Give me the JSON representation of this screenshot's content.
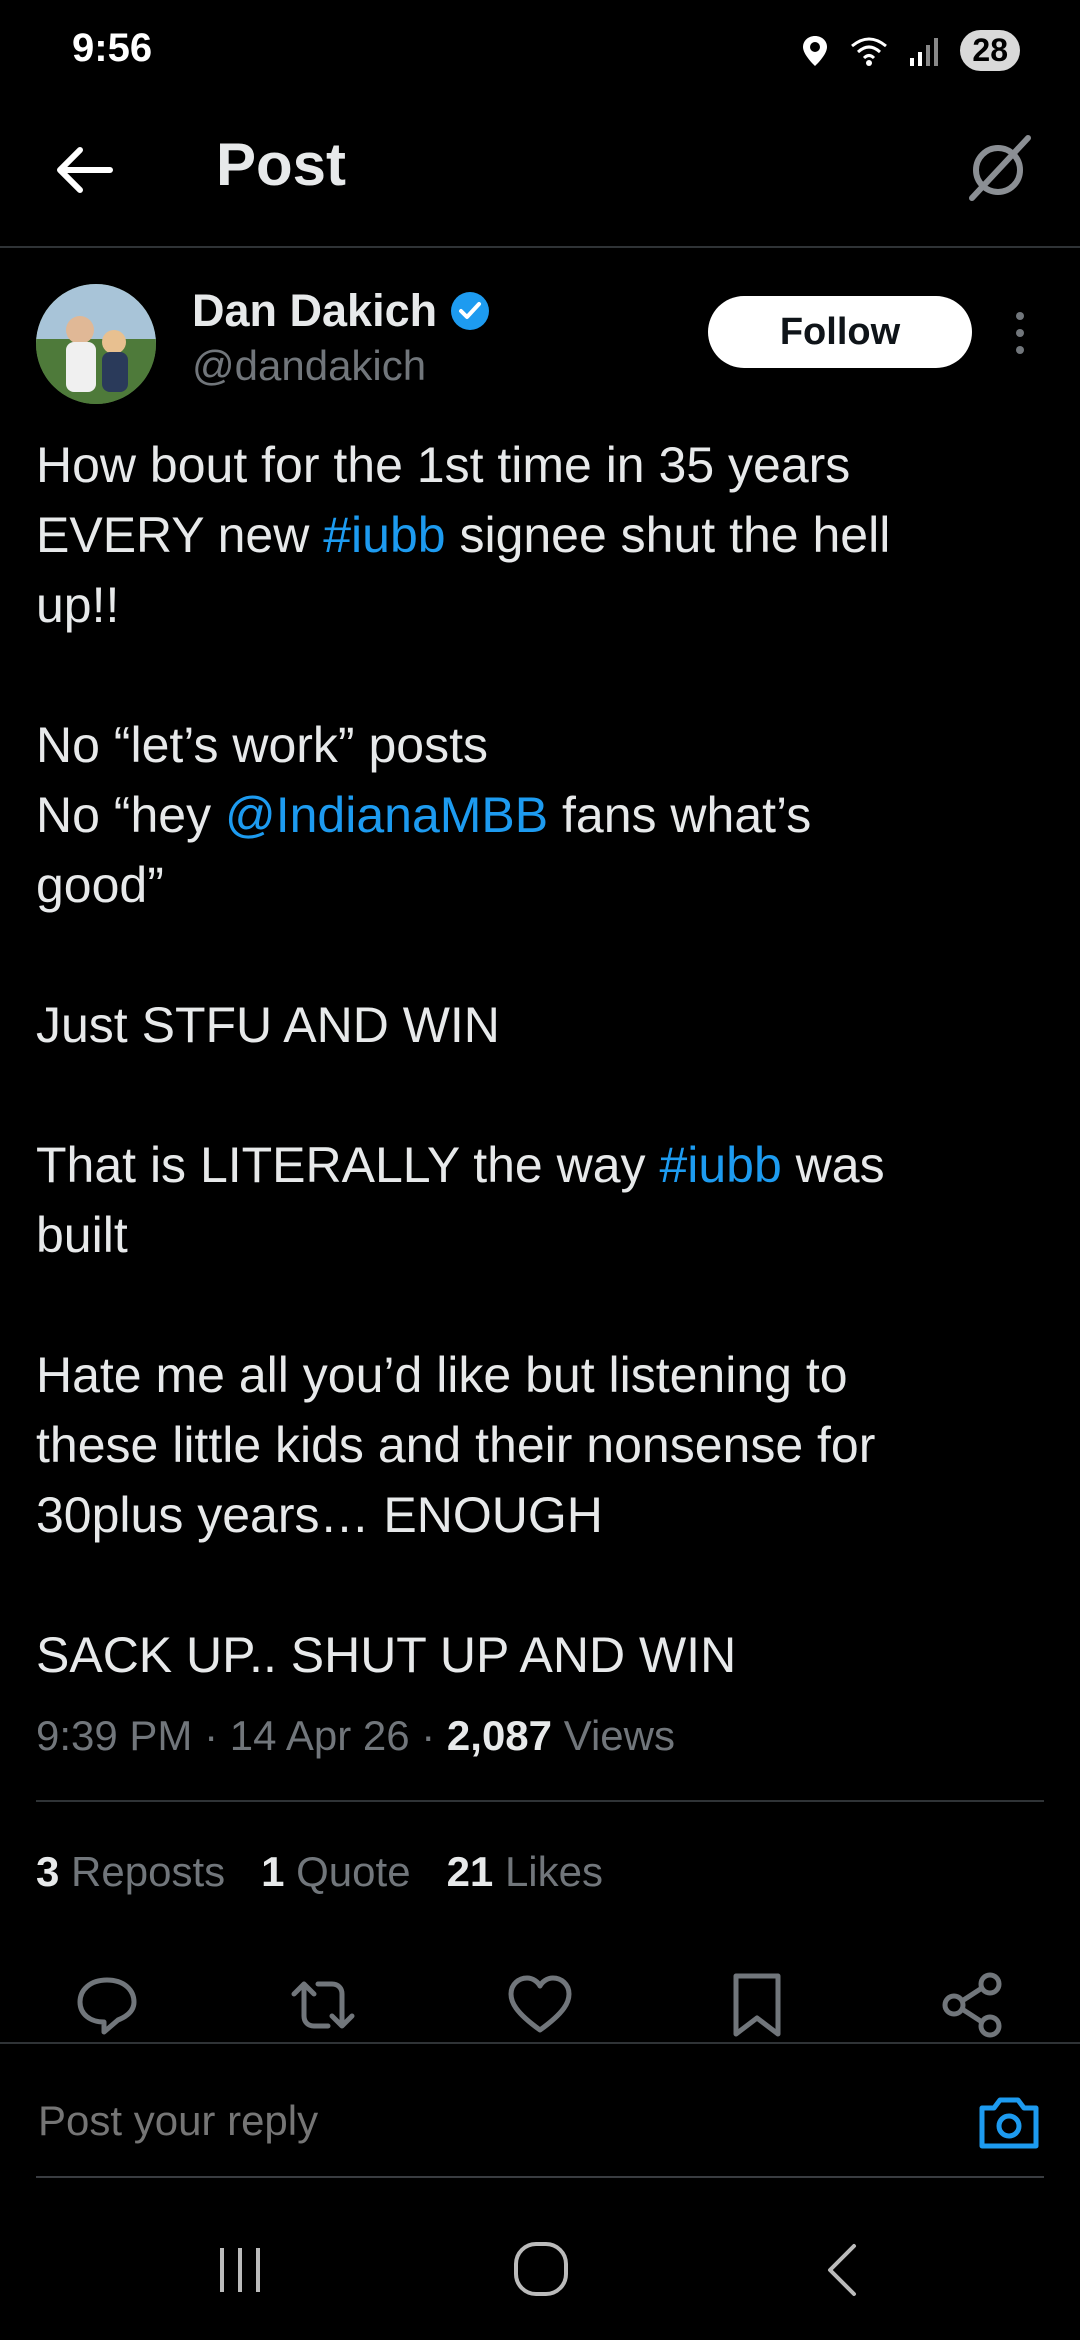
{
  "status_bar": {
    "time": "9:56",
    "battery": "28"
  },
  "header": {
    "title": "Post"
  },
  "author": {
    "name": "Dan Dakich",
    "handle": "@dandakich",
    "follow_label": "Follow"
  },
  "post": {
    "line1": "How bout for the 1st time in 35 years",
    "line2_pre": "EVERY new ",
    "hashtag1": "#iubb",
    "line2_post": " signee shut the hell",
    "line3": "up!!",
    "line4": "No “let’s work” posts",
    "line5_pre": "No “hey ",
    "mention": "@IndianaMBB",
    "line5_post": " fans what’s",
    "line6": "good”",
    "line7": "Just STFU AND WIN",
    "line8_pre": "That is LITERALLY the way ",
    "hashtag2": "#iubb",
    "line8_post": " was",
    "line9": "built",
    "line10": "Hate me all you’d like but listening to",
    "line11": "these little kids and their nonsense for",
    "line12": "30plus years… ENOUGH",
    "line13": "SACK UP.. SHUT UP AND WIN"
  },
  "meta": {
    "time": "9:39 PM",
    "date": "14 Apr 26",
    "views_count": "2,087",
    "views_label": "Views",
    "separator": "·"
  },
  "stats": {
    "reposts_count": "3",
    "reposts_label": "Reposts",
    "quotes_count": "1",
    "quotes_label": "Quote",
    "likes_count": "21",
    "likes_label": "Likes"
  },
  "reply": {
    "placeholder": "Post your reply"
  },
  "colors": {
    "accent": "#1d9bf0",
    "background": "#000000",
    "muted": "#71767b"
  }
}
